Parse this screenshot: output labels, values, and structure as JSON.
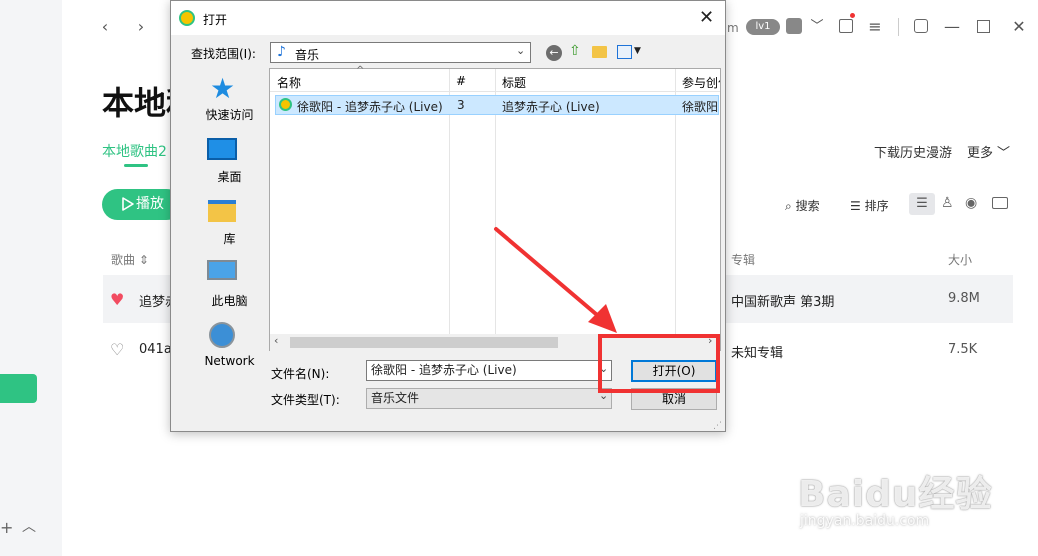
{
  "app": {
    "page_title": "本地和",
    "tab_local": "本地歌曲2",
    "play_button": "播放",
    "right_links": {
      "download_history": "下载历史漫游",
      "more": "更多"
    },
    "toolbar": {
      "search": "搜索",
      "sort": "排序"
    },
    "columns": {
      "song": "歌曲",
      "album": "专辑",
      "size": "大小"
    },
    "rows": [
      {
        "name": "追梦赤",
        "album": "中国新歌声 第3期",
        "size": "9.8M",
        "liked": true
      },
      {
        "name": "041ad",
        "album": "未知专辑",
        "size": "7.5K",
        "liked": false
      }
    ],
    "top_label": "m",
    "badge": "lv1"
  },
  "dialog": {
    "title": "打开",
    "look_in_label": "查找范围(I):",
    "look_in_value": "音乐",
    "places": [
      "快速访问",
      "桌面",
      "库",
      "此电脑",
      "Network"
    ],
    "columns": {
      "name": "名称",
      "number": "#",
      "title": "标题",
      "artist": "参与创作"
    },
    "file": {
      "name": "徐歌阳 - 追梦赤子心 (Live)",
      "number": "3",
      "title": "追梦赤子心 (Live)",
      "artist": "徐歌阳"
    },
    "filename_label": "文件名(N):",
    "filename_value": "徐歌阳 - 追梦赤子心 (Live)",
    "filetype_label": "文件类型(T):",
    "filetype_value": "音乐文件",
    "open_button": "打开(O)",
    "cancel_button": "取消"
  },
  "watermark": {
    "brand": "Baidu经验",
    "url": "jingyan.baidu.com"
  },
  "colors": {
    "accent": "#2fc383",
    "annotation": "#f03232",
    "selection": "#cce8ff"
  }
}
